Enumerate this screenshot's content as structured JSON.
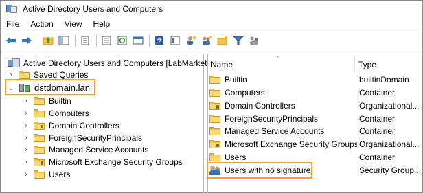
{
  "window": {
    "title": "Active Directory Users and Computers"
  },
  "menu": [
    "File",
    "Action",
    "View",
    "Help"
  ],
  "toolbar_icons": [
    "back-arrow-icon",
    "forward-arrow-icon",
    "up-folder-icon",
    "show-hide-tree-icon",
    "properties-icon",
    "export-list-icon",
    "refresh-icon",
    "console-icon",
    "help-icon",
    "details-icon",
    "new-user-icon",
    "new-group-icon",
    "new-ou-icon",
    "filter-icon",
    "delegate-icon"
  ],
  "tree": {
    "root_label": "Active Directory Users and Computers [LabMarket",
    "saved_queries": "Saved Queries",
    "domain": "dstdomain.lan",
    "children": [
      {
        "label": "Builtin",
        "special": false
      },
      {
        "label": "Computers",
        "special": false
      },
      {
        "label": "Domain Controllers",
        "special": true
      },
      {
        "label": "ForeignSecurityPrincipals",
        "special": false
      },
      {
        "label": "Managed Service Accounts",
        "special": false
      },
      {
        "label": "Microsoft Exchange Security Groups",
        "special": true
      },
      {
        "label": "Users",
        "special": false
      }
    ]
  },
  "list": {
    "columns": [
      "Name",
      "Type"
    ],
    "rows": [
      {
        "name": "Builtin",
        "type": "builtinDomain",
        "icon": "folder"
      },
      {
        "name": "Computers",
        "type": "Container",
        "icon": "folder"
      },
      {
        "name": "Domain Controllers",
        "type": "Organizational...",
        "icon": "ou"
      },
      {
        "name": "ForeignSecurityPrincipals",
        "type": "Container",
        "icon": "folder"
      },
      {
        "name": "Managed Service Accounts",
        "type": "Container",
        "icon": "folder"
      },
      {
        "name": "Microsoft Exchange Security Groups",
        "type": "Organizational...",
        "icon": "ou"
      },
      {
        "name": "Users",
        "type": "Container",
        "icon": "folder"
      },
      {
        "name": "Users with no signature",
        "type": "Security Group...",
        "icon": "group"
      }
    ]
  },
  "colors": {
    "highlight": "#f0a02b",
    "folder": "#f2c34d"
  }
}
